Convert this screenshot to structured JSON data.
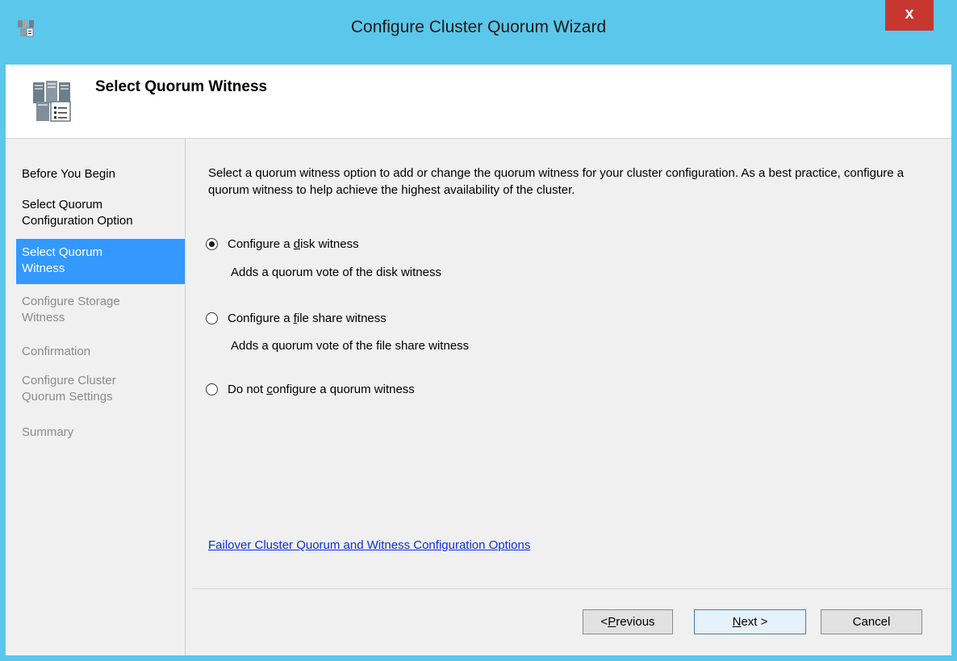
{
  "window": {
    "title": "Configure Cluster Quorum Wizard",
    "close_label": "x",
    "accent_color": "#5bc7ea"
  },
  "header": {
    "title": "Select Quorum Witness",
    "icon": "cluster-server-icon"
  },
  "nav": {
    "items": [
      {
        "label": "Before You Begin",
        "state": "enabled"
      },
      {
        "label": "Select Quorum Configuration Option",
        "state": "enabled"
      },
      {
        "label": "Select Quorum Witness",
        "state": "selected"
      },
      {
        "label": "Configure Storage Witness",
        "state": "disabled"
      },
      {
        "label": "Confirmation",
        "state": "disabled"
      },
      {
        "label": "Configure Cluster Quorum Settings",
        "state": "disabled"
      },
      {
        "label": "Summary",
        "state": "disabled"
      }
    ]
  },
  "content": {
    "description": "Select a quorum witness option to add or change the quorum witness for your cluster configuration. As a best practice, configure a quorum witness to help achieve the highest availability of the cluster.",
    "options": [
      {
        "label_pre": "Configure a ",
        "accel": "d",
        "label_post": "isk witness",
        "sub": "Adds a quorum vote of the disk witness",
        "selected": true
      },
      {
        "label_pre": "Configure a ",
        "accel": "f",
        "label_post": "ile share witness",
        "sub": "Adds a quorum vote of the file share witness",
        "selected": false
      },
      {
        "label_pre": "Do not ",
        "accel": "c",
        "label_post": "onfigure a quorum witness",
        "sub": "",
        "selected": false
      }
    ],
    "help_link": "Failover Cluster Quorum and Witness Configuration Options"
  },
  "footer": {
    "previous": {
      "prefix": "< ",
      "accel": "P",
      "rest": "revious"
    },
    "next": {
      "accel": "N",
      "rest": "ext >"
    },
    "cancel": "Cancel"
  }
}
